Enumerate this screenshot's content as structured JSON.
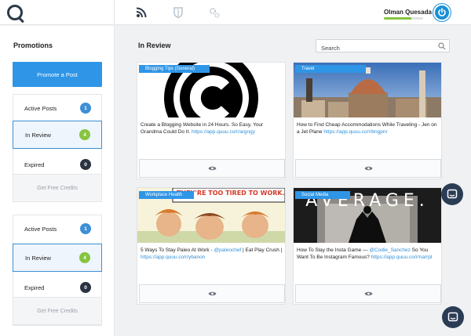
{
  "user": {
    "name": "Olman Quesada",
    "progress": 0.7
  },
  "sidebar": {
    "title": "Promotions",
    "promote_label": "Promote a Post",
    "groups": [
      {
        "items": [
          {
            "label": "Active Posts",
            "count": "1"
          },
          {
            "label": "In Review",
            "count": "4"
          },
          {
            "label": "Expired",
            "count": "0"
          }
        ],
        "credits_label": "Get Free Credits"
      },
      {
        "items": [
          {
            "label": "Active Posts",
            "count": "1"
          },
          {
            "label": "In Review",
            "count": "4"
          },
          {
            "label": "Expired",
            "count": "0"
          }
        ],
        "credits_label": "Get Free Credits"
      }
    ]
  },
  "main": {
    "title": "In Review",
    "search_placeholder": "Search",
    "cards": [
      {
        "tag": "Blogging Tips (General)",
        "text": "Create a Blogging Website in 24 Hours. So Easy, Your Grandma Could Do It.",
        "link": "https://app.quuu.co/r/argngy"
      },
      {
        "tag": "Travel",
        "text": "How to Find Cheap Accommodations While Traveling - Jen on a Jet Plane",
        "link": "https://app.quuu.co/r/bngpnr"
      },
      {
        "tag": "Workplace Health",
        "image_caption": "THEY'RE TOO TIRED TO WORK.",
        "text_pre": "5 Ways To Stay Paleo At Work - ",
        "mention": "@paleochef",
        "text_post": " | Eat Play Crush |",
        "link": "https://app.quuu.co/r/ybanon"
      },
      {
        "tag": "Social Media",
        "image_caption": "AVERAGE.",
        "text_pre": "How To Slay the Insta Game — ",
        "mention": "@Codie_Sanchez",
        "text_post": " So You Want To Be Instagram Famous?",
        "link": "https://app.quuu.co/r/narrpl"
      }
    ]
  },
  "colors": {
    "accent": "#2f95e6",
    "badge_blue": "#3d8fd6",
    "badge_green": "#86c440",
    "badge_dark": "#2b3340",
    "chat": "#2b3c55"
  },
  "icons": [
    "quuu-logo-icon",
    "broadcast-icon",
    "shield-icon",
    "gears-icon",
    "power-icon",
    "search-icon",
    "eye-icon",
    "chat-icon"
  ]
}
